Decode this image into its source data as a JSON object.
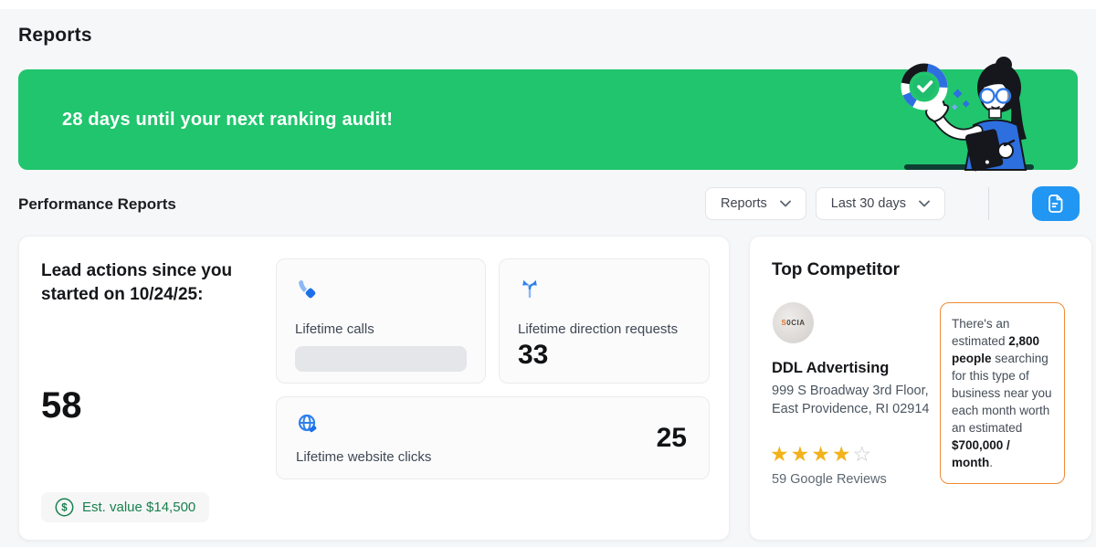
{
  "page": {
    "title": "Reports"
  },
  "banner": {
    "text": "28 days until your next ranking audit!"
  },
  "toolbar": {
    "section_title": "Performance Reports",
    "report_dropdown": {
      "value": "Reports"
    },
    "range_dropdown": {
      "value": "Last 30 days"
    }
  },
  "lead_summary": {
    "heading": "Lead actions since you started on 10/24/25:",
    "total": "58",
    "est_value_label": "Est. value $14,500"
  },
  "metrics": [
    {
      "icon": "phone-icon",
      "label": "Lifetime calls",
      "value": null,
      "loading": true
    },
    {
      "icon": "directions-icon",
      "label": "Lifetime direction requests",
      "value": "33"
    },
    {
      "icon": "globe-icon",
      "label": "Lifetime website clicks",
      "value": "25"
    }
  ],
  "competitor": {
    "heading": "Top Competitor",
    "avatar_text": "S0CIA",
    "name": "DDL Advertising",
    "address": "999 S Broadway 3rd Floor, East Providence, RI 02914",
    "rating": 4,
    "rating_max": 5,
    "reviews": "59 Google Reviews",
    "callout": {
      "text_1": "There's an estimated ",
      "bold_1": "2,800 people",
      "text_2": " searching for this type of business near you each month worth an estimated ",
      "bold_2": "$700,000 / month",
      "text_3": "."
    }
  },
  "colors": {
    "banner_green": "#20c56d",
    "export_blue": "#2196f3",
    "accent_blue": "#2f80ed",
    "star_gold": "#f2b21c",
    "callout_orange": "#ee8b33",
    "est_green": "#17814d"
  }
}
